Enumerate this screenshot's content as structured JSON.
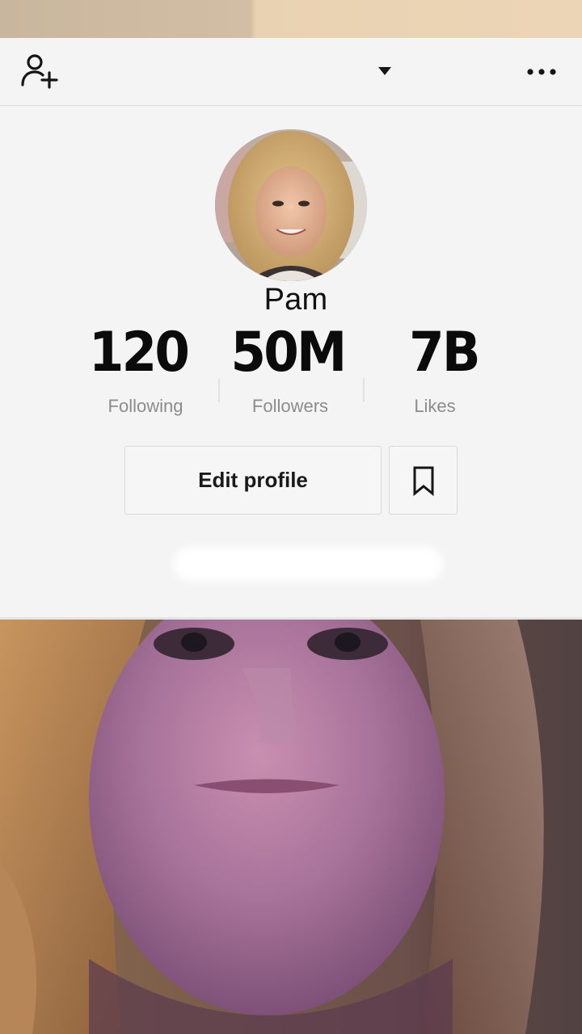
{
  "header": {
    "add_user_icon": "add-user-icon",
    "dropdown_icon": "caret-down-icon",
    "more_icon": "more-horizontal-icon"
  },
  "profile": {
    "name": "Pam",
    "stats": [
      {
        "value": "120",
        "label": "Following"
      },
      {
        "value": "50M",
        "label": "Followers"
      },
      {
        "value": "7B",
        "label": "Likes"
      }
    ],
    "edit_button_label": "Edit profile",
    "bookmark_icon": "bookmark-icon"
  },
  "colors": {
    "background": "#f4f4f4",
    "text_primary": "#111111",
    "text_secondary": "#8c8c8c",
    "border": "#d9d9d9"
  }
}
